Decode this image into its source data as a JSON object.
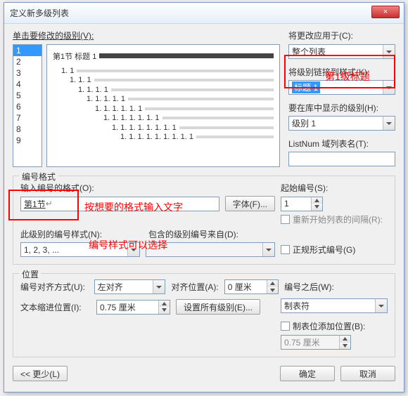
{
  "title": "定义新多级列表",
  "close": "×",
  "clickLevel": "单击要修改的级别(V):",
  "levels": [
    "1",
    "2",
    "3",
    "4",
    "5",
    "6",
    "7",
    "8",
    "9"
  ],
  "preview": {
    "line1": "第1节 标题 1",
    "indent_labels": [
      "1. 1",
      "1. 1. 1",
      "1. 1. 1. 1",
      "1. 1. 1. 1. 1",
      "1. 1. 1. 1. 1. 1",
      "1. 1. 1. 1. 1. 1. 1",
      "1. 1. 1. 1. 1. 1. 1. 1",
      "1. 1. 1. 1. 1. 1. 1. 1. 1"
    ]
  },
  "applyTo": {
    "label": "将更改应用于(C):",
    "value": "整个列表"
  },
  "linkStyle": {
    "label": "将级别链接到样式(K):",
    "value": "标题 1"
  },
  "showInGallery": {
    "label": "要在库中显示的级别(H):",
    "value": "级别 1"
  },
  "listNum": "ListNum 域列表名(T):",
  "numFormatGroup": "编号格式",
  "enterFormat": "输入编号的格式(O):",
  "formatValue": "第1节",
  "fontBtn": "字体(F)...",
  "startAt": {
    "label": "起始编号(S):",
    "value": "1"
  },
  "restart": "重新开始列表的间隔(R):",
  "thisLevelStyle": {
    "label": "此级别的编号样式(N):",
    "value": "1, 2, 3, ..."
  },
  "include": "包含的级别编号来自(D):",
  "legal": "正规形式编号(G)",
  "posGroup": "位置",
  "align": {
    "label": "编号对齐方式(U):",
    "value": "左对齐"
  },
  "alignAt": {
    "label": "对齐位置(A):",
    "value": "0 厘米"
  },
  "follow": {
    "label": "编号之后(W):",
    "value": "制表符"
  },
  "indent": {
    "label": "文本缩进位置(I):",
    "value": "0.75 厘米"
  },
  "setAll": "设置所有级别(E)...",
  "tabAdd": "制表位添加位置(B):",
  "tabVal": "0.75 厘米",
  "less": "<< 更少(L)",
  "ok": "确定",
  "cancel": "取消",
  "annot1": "第1级标题",
  "annot2": "按想要的格式输入文字",
  "annot3": "编号样式可以选择"
}
